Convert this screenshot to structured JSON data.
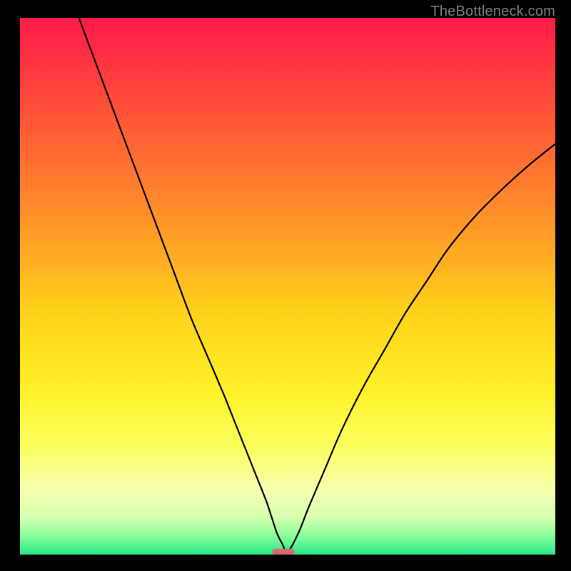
{
  "watermark": "TheBottleneck.com",
  "chart_data": {
    "type": "line",
    "title": "",
    "xlabel": "",
    "ylabel": "",
    "xlim": [
      0,
      100
    ],
    "ylim": [
      0,
      100
    ],
    "gradient_stops": [
      {
        "offset": 0.0,
        "color": "#ff1a4a"
      },
      {
        "offset": 0.15,
        "color": "#ff4a3a"
      },
      {
        "offset": 0.35,
        "color": "#ff8a2a"
      },
      {
        "offset": 0.55,
        "color": "#ffd21a"
      },
      {
        "offset": 0.7,
        "color": "#fff22a"
      },
      {
        "offset": 0.8,
        "color": "#fbff60"
      },
      {
        "offset": 0.88,
        "color": "#f5ffb0"
      },
      {
        "offset": 0.93,
        "color": "#d8ffb0"
      },
      {
        "offset": 0.965,
        "color": "#88ff9a"
      },
      {
        "offset": 1.0,
        "color": "#28e88a"
      }
    ],
    "series": [
      {
        "name": "bottleneck-curve",
        "x": [
          11,
          14,
          17,
          20,
          23,
          26,
          29,
          32,
          35,
          38,
          40,
          42,
          44,
          46,
          47,
          48,
          49,
          50,
          52,
          54,
          57,
          60,
          64,
          68,
          72,
          76,
          80,
          85,
          90,
          95,
          100
        ],
        "y": [
          100,
          92,
          84,
          76,
          68,
          60,
          52,
          44,
          37,
          30,
          25,
          20,
          15,
          10,
          7,
          4,
          2,
          0.5,
          4,
          9,
          16,
          23,
          31,
          38,
          45,
          51,
          57,
          63,
          68,
          72.5,
          76.5
        ]
      }
    ],
    "marker": {
      "name": "optimal-marker",
      "x": 49.2,
      "y": 0.5,
      "width": 4.2,
      "height": 1.2,
      "color": "#d86a6a"
    }
  }
}
